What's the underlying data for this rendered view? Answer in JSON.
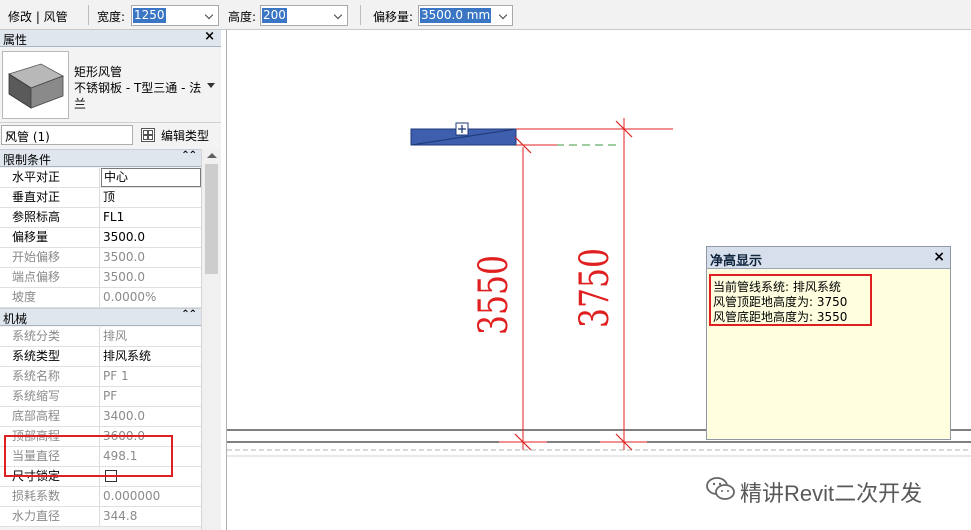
{
  "options_bar": {
    "context": "修改 | 风管",
    "width_label": "宽度:",
    "width_value": "1250",
    "height_label": "高度:",
    "height_value": "200",
    "offset_label": "偏移量:",
    "offset_value": "3500.0 mm"
  },
  "properties": {
    "title": "属性",
    "close": "×",
    "family_name": "矩形风管",
    "type_name_line1": "不锈钢板 - T型三通 - 法",
    "type_name_line2": "兰",
    "instance_selector": "风管 (1)",
    "edit_type": "编辑类型",
    "groups": [
      {
        "title": "限制条件",
        "rows": [
          {
            "key": "水平对正",
            "value": "中心"
          },
          {
            "key": "垂直对正",
            "value": "顶"
          },
          {
            "key": "参照标高",
            "value": "FL1"
          },
          {
            "key": "偏移量",
            "value": "3500.0"
          },
          {
            "key": "开始偏移",
            "value": "3500.0"
          },
          {
            "key": "端点偏移",
            "value": "3500.0"
          },
          {
            "key": "坡度",
            "value": "0.0000%"
          }
        ]
      },
      {
        "title": "机械",
        "rows": [
          {
            "key": "系统分类",
            "value": "排风"
          },
          {
            "key": "系统类型",
            "value": "排风系统"
          },
          {
            "key": "系统名称",
            "value": "PF 1"
          },
          {
            "key": "系统缩写",
            "value": "PF"
          },
          {
            "key": "底部高程",
            "value": "3400.0"
          },
          {
            "key": "顶部高程",
            "value": "3600.0"
          },
          {
            "key": "当量直径",
            "value": "498.1"
          },
          {
            "key": "尺寸锁定",
            "value": ""
          },
          {
            "key": "损耗系数",
            "value": "0.000000"
          },
          {
            "key": "水力直径",
            "value": "344.8"
          }
        ]
      }
    ]
  },
  "drawing": {
    "dim_left": "3550",
    "dim_right": "3750"
  },
  "clearance_popup": {
    "title": "净高显示",
    "close": "×",
    "line1": "当前管线系统: 排风系统",
    "line2": "风管顶距地高度为: 3750",
    "line3": "风管底距地高度为: 3550"
  },
  "watermark": "精讲Revit二次开发",
  "colors": {
    "duct_fill": "#3d5fae",
    "dimension_red": "#e02020",
    "selection_blue": "#3a76c4",
    "popup_bg": "#ffffe0"
  }
}
